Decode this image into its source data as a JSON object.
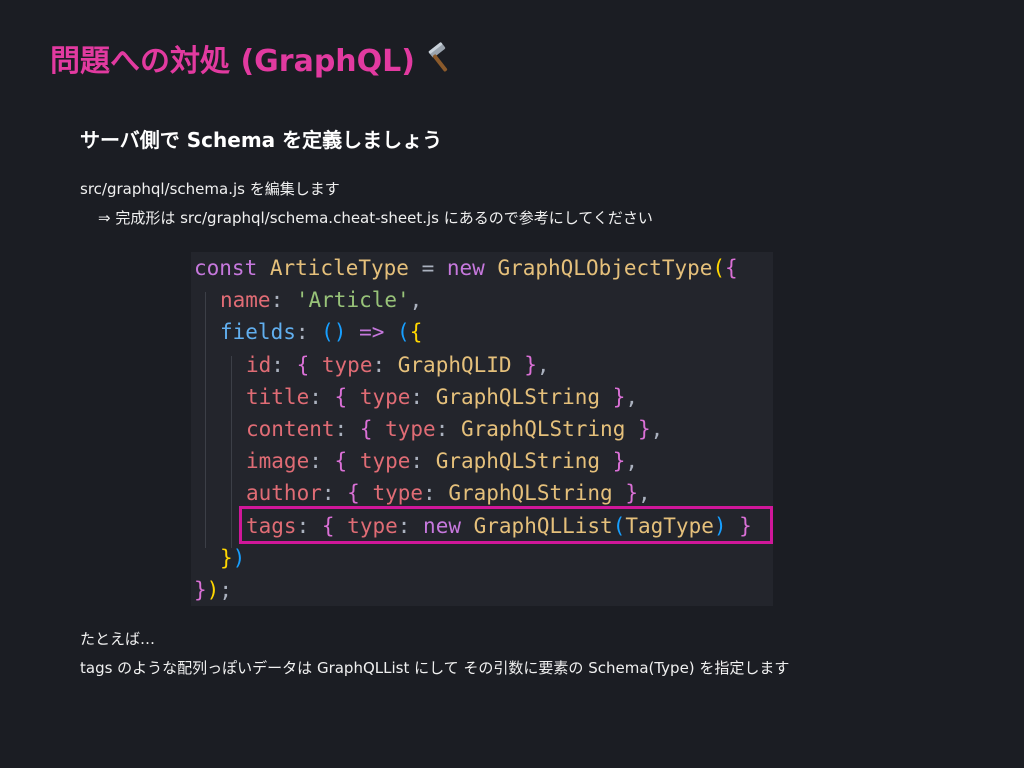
{
  "slide": {
    "title": "問題への対処 (GraphQL)",
    "title_icon": "hammer-icon",
    "subheading": "サーバ側で Schema を定義しましょう",
    "instruction": "src/graphql/schema.js を編集します",
    "hint": "⇒ 完成形は src/graphql/schema.cheat-sheet.js にあるので参考にしてください",
    "example_intro": "たとえば…",
    "example_text": "tags のような配列っぽいデータは GraphQLList にして その引数に要素の Schema(Type) を指定します"
  },
  "colors": {
    "accent": "#e23aa0",
    "background": "#1b1d23",
    "highlight_border": "#d0179a",
    "code_background": "#23252c"
  },
  "code": {
    "l1": {
      "a": "const ",
      "b": "ArticleType",
      "c": " = ",
      "d": "new ",
      "e": "GraphQLObjectType",
      "f": "(",
      "g": "{"
    },
    "l2": {
      "a": "name",
      "b": ": ",
      "c": "'Article'",
      "d": ","
    },
    "l3": {
      "a": "fields",
      "b": ": ",
      "c": "()",
      "d": " => ",
      "e": "(",
      "f": "{"
    },
    "l4": {
      "a": "id",
      "b": ": ",
      "c": "{ ",
      "d": "type",
      "e": ": ",
      "f": "GraphQLID",
      "g": " }",
      "h": ","
    },
    "l5": {
      "a": "title",
      "b": ": ",
      "c": "{ ",
      "d": "type",
      "e": ": ",
      "f": "GraphQLString",
      "g": " }",
      "h": ","
    },
    "l6": {
      "a": "content",
      "b": ": ",
      "c": "{ ",
      "d": "type",
      "e": ": ",
      "f": "GraphQLString",
      "g": " }",
      "h": ","
    },
    "l7": {
      "a": "image",
      "b": ": ",
      "c": "{ ",
      "d": "type",
      "e": ": ",
      "f": "GraphQLString",
      "g": " }",
      "h": ","
    },
    "l8": {
      "a": "author",
      "b": ": ",
      "c": "{ ",
      "d": "type",
      "e": ": ",
      "f": "GraphQLString",
      "g": " }",
      "h": ","
    },
    "l9": {
      "a": "tags",
      "b": ": ",
      "c": "{ ",
      "d": "type",
      "e": ": ",
      "f": "new ",
      "g": "GraphQLList",
      "h": "(",
      "i": "TagType",
      "j": ")",
      "k": " }"
    },
    "l10": {
      "a": "}",
      "b": ")"
    },
    "l11": {
      "a": "}",
      "b": ")",
      "c": ";"
    }
  }
}
